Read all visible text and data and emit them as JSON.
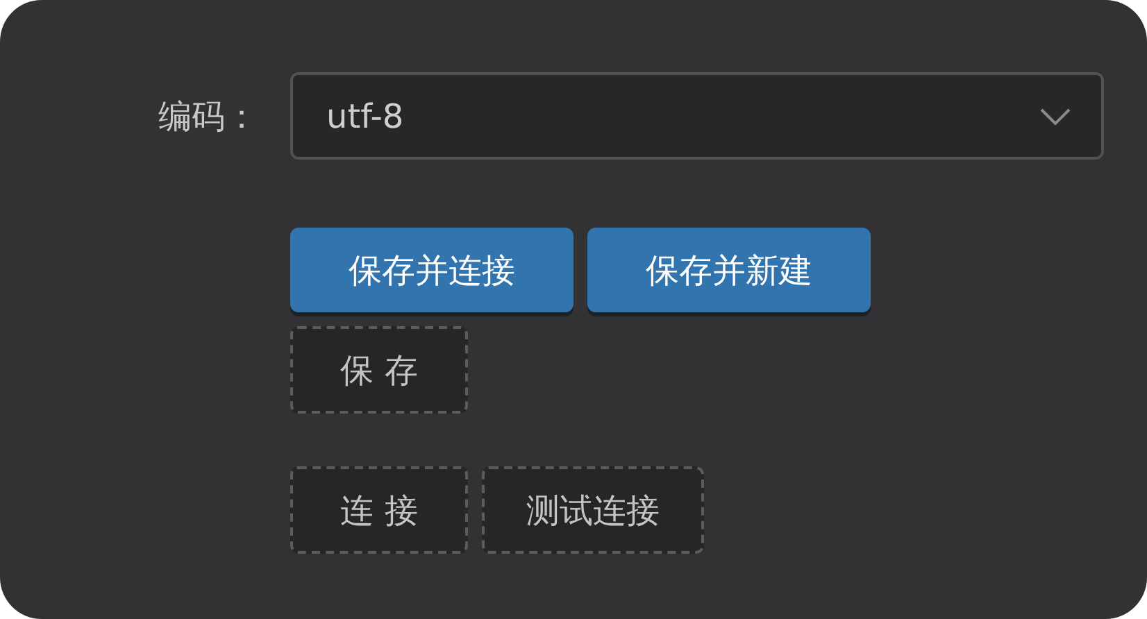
{
  "form": {
    "label": "编码：",
    "encoding": {
      "value": "utf-8"
    }
  },
  "button_rows": [
    [
      {
        "label": "保存并连接",
        "kind": "primary"
      },
      {
        "label": "保存并新建",
        "kind": "primary"
      }
    ],
    [
      {
        "label": "保 存",
        "kind": "dashed"
      }
    ],
    [
      {
        "label": "连 接",
        "kind": "dashed"
      },
      {
        "label": "测试连接",
        "kind": "dashed"
      }
    ]
  ]
}
